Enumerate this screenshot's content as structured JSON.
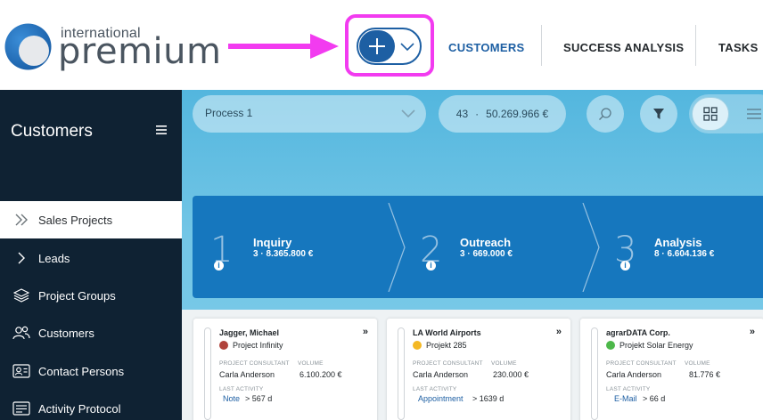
{
  "logo": {
    "small": "international",
    "big": "premium"
  },
  "header": {
    "nav": [
      "CUSTOMERS",
      "SUCCESS ANALYSIS",
      "TASKS"
    ],
    "active_color": "#1d5fa3",
    "highlight_color": "#f23bf0"
  },
  "sidebar": {
    "title": "Customers",
    "items": [
      {
        "label": "Sales Projects",
        "icon": "double-chevron-icon",
        "active": true
      },
      {
        "label": "Leads",
        "icon": "chevron-right-icon"
      },
      {
        "label": "Project Groups",
        "icon": "layers-icon"
      },
      {
        "label": "Customers",
        "icon": "users-icon"
      },
      {
        "label": "Contact Persons",
        "icon": "contact-card-icon"
      },
      {
        "label": "Activity Protocol",
        "icon": "protocol-icon"
      }
    ]
  },
  "filter": {
    "process": "Process 1",
    "count": "43",
    "separator": "·",
    "total": "50.269.966 €"
  },
  "stages": [
    {
      "num": "1",
      "title": "Inquiry",
      "sub": "3 · 8.365.800 €"
    },
    {
      "num": "2",
      "title": "Outreach",
      "sub": "3 · 669.000 €"
    },
    {
      "num": "3",
      "title": "Analysis",
      "sub": "8 · 6.604.136 €"
    }
  ],
  "cards_labels": {
    "consultant": "PROJECT CONSULTANT",
    "volume": "VOLUME",
    "last_activity": "LAST ACTIVITY",
    "forward": "»",
    "days_arrow": ">"
  },
  "cards": [
    {
      "name": "Jagger, Michael",
      "project": "Project Infinity",
      "dot": "#b0433b",
      "consultant": "Carla Anderson",
      "volume": "6.100.200 €",
      "activity": "Note",
      "days": "567 d"
    },
    {
      "name": "LA World Airports",
      "project": "Projekt 285",
      "dot": "#f4b823",
      "consultant": "Carla Anderson",
      "volume": "230.000 €",
      "activity": "Appointment",
      "days": "1639 d"
    },
    {
      "name": "agrarDATA Corp.",
      "project": "Projekt Solar Energy",
      "dot": "#4db84a",
      "consultant": "Carla Anderson",
      "volume": "81.776 €",
      "activity": "E-Mail",
      "days": "66 d"
    }
  ]
}
